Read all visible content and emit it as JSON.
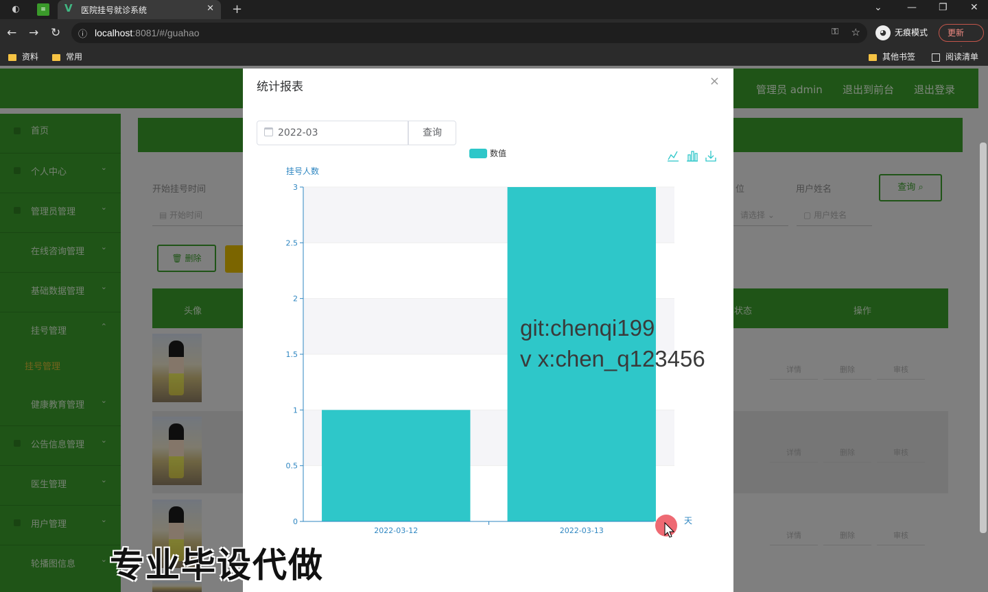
{
  "browser": {
    "tab_title": "医院挂号就诊系统",
    "url_host": "localhost",
    "url_rest": ":8081/#/guahao",
    "incognito_label": "无痕模式",
    "update_label": "更新",
    "bookmarks": [
      "资料",
      "常用"
    ],
    "bookmarks_right": [
      "其他书签",
      "阅读清单"
    ]
  },
  "app": {
    "header_user": "管理员 admin",
    "header_links": [
      "退出到前台",
      "退出登录"
    ],
    "sidebar": [
      {
        "label": "首页"
      },
      {
        "label": "个人中心"
      },
      {
        "label": "管理员管理"
      },
      {
        "label": "在线咨询管理"
      },
      {
        "label": "基础数据管理"
      },
      {
        "label": "挂号管理"
      },
      {
        "label": "健康教育管理"
      },
      {
        "label": "公告信息管理"
      },
      {
        "label": "医生管理"
      },
      {
        "label": "用户管理"
      },
      {
        "label": "轮播图信息"
      }
    ],
    "sidebar_sub": "挂号管理",
    "search_time_label": "开始挂号时间",
    "search_time_placeholder": "开始时间",
    "search_user_label": "用户姓名",
    "search_user_placeholder": "用户姓名",
    "search_select_placeholder": "请选择",
    "search_col_label": "位",
    "query_button": "查询",
    "delete_button": "删除",
    "table_headers": [
      "头像",
      "状态",
      "操作"
    ],
    "row_actions": [
      "详情",
      "删除",
      "审核"
    ]
  },
  "modal": {
    "title": "统计报表",
    "month_value": "2022-03",
    "query_label": "查询"
  },
  "chart_data": {
    "type": "bar",
    "legend": [
      "数值"
    ],
    "ylabel": "挂号人数",
    "xlabel": "天",
    "categories": [
      "2022-03-12",
      "2022-03-13"
    ],
    "values": [
      1,
      3
    ],
    "ylim": [
      0,
      3
    ],
    "yticks": [
      "0",
      "0.5",
      "1",
      "1.5",
      "2",
      "2.5",
      "3"
    ],
    "bar_color": "#2ec7c9",
    "legend_position": "top-center"
  },
  "watermarks": {
    "line1": "git:chenqi199",
    "line2": "v x:chen_q123456",
    "bottom": "专业毕设代做"
  }
}
